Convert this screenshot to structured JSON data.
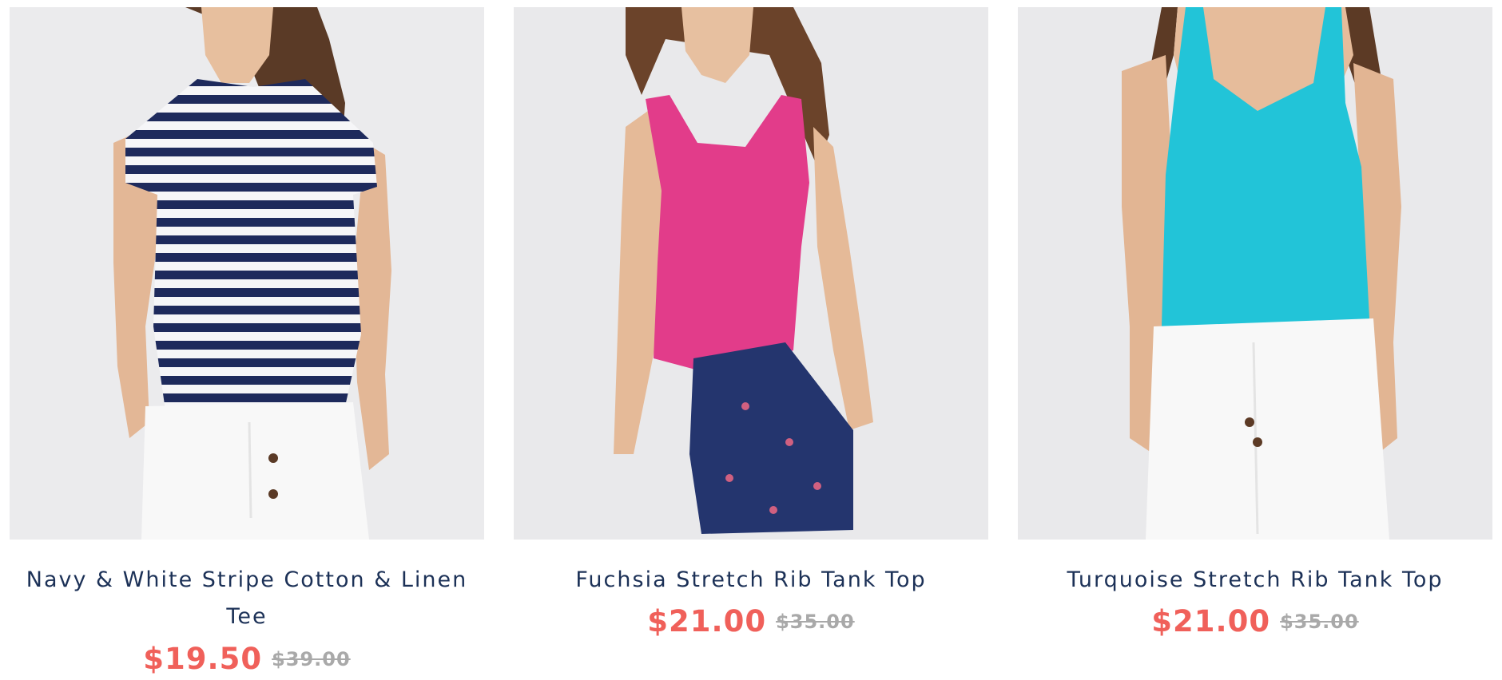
{
  "theme": {
    "title_color": "#1c3157",
    "sale_color": "#f0605a",
    "original_price_color": "#a9a9a9",
    "photo_background": "#eaeaec"
  },
  "products": [
    {
      "name": "Navy & White Stripe Cotton & Linen Tee",
      "sale_price": "$19.50",
      "original_price": "$39.00",
      "top_color": "#1e2a5c",
      "bottom_color": "#f7f7f7"
    },
    {
      "name": "Fuchsia Stretch Rib Tank Top",
      "sale_price": "$21.00",
      "original_price": "$35.00",
      "top_color": "#e23c8a",
      "bottom_color": "#24356e"
    },
    {
      "name": "Turquoise Stretch Rib Tank Top",
      "sale_price": "$21.00",
      "original_price": "$35.00",
      "top_color": "#22c4d8",
      "bottom_color": "#f7f7f7"
    }
  ]
}
